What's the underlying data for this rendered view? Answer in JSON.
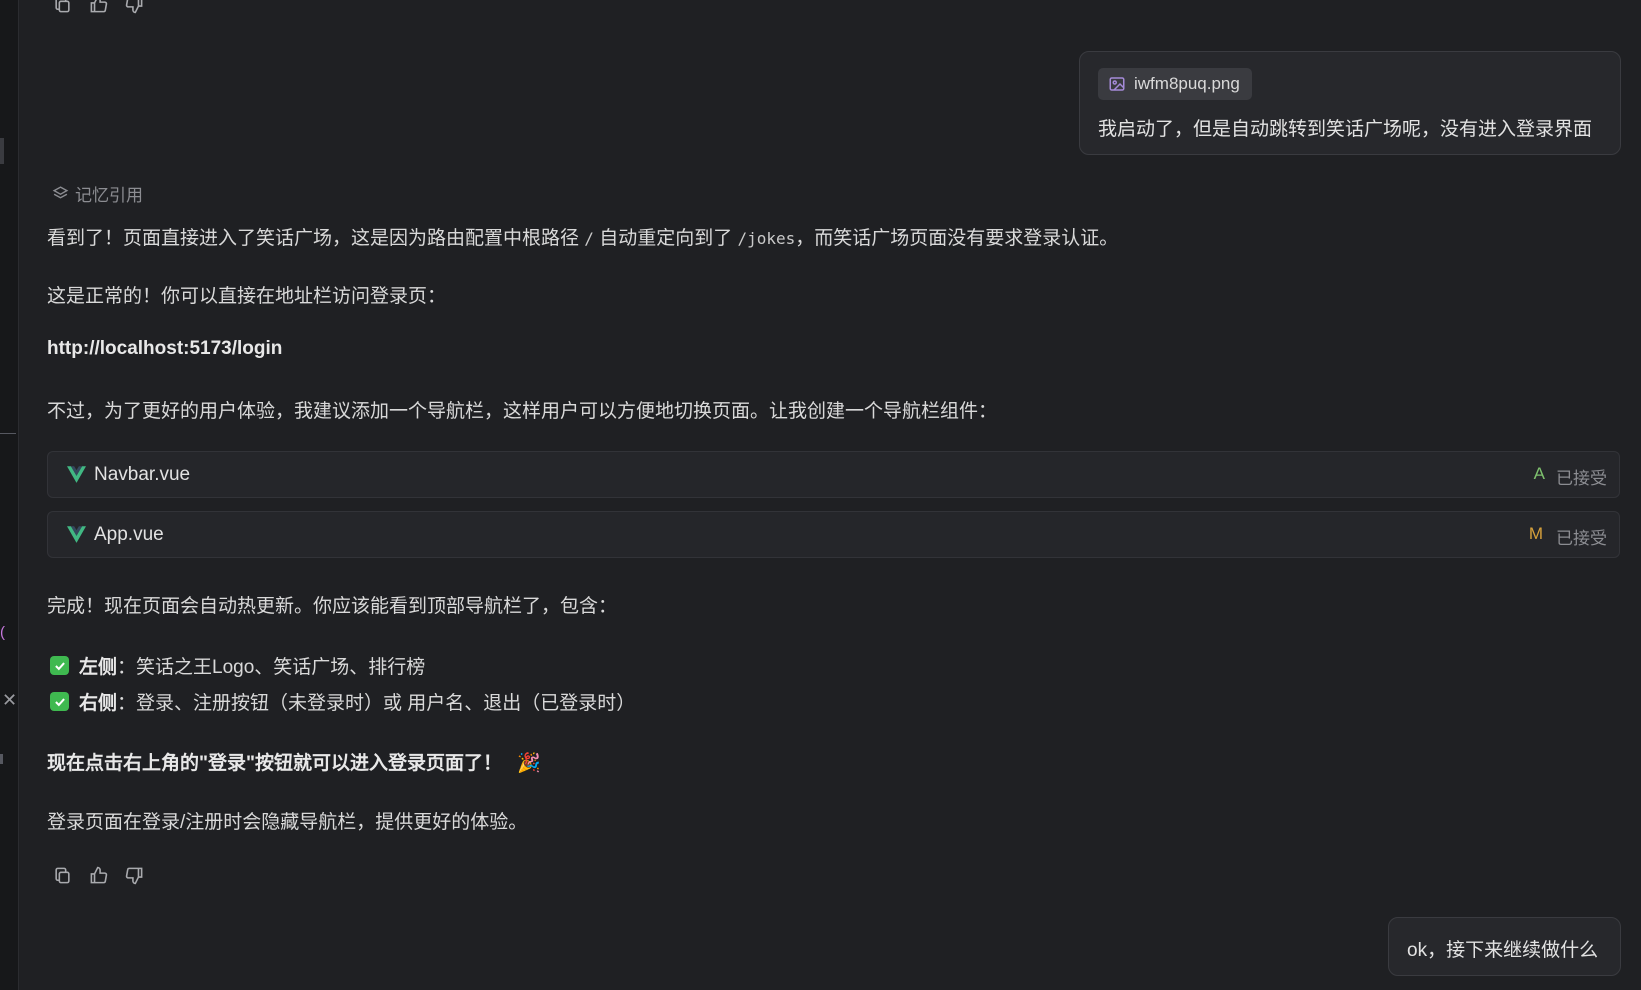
{
  "top_actions": {
    "icons": [
      "copy-icon",
      "thumbs-up-icon",
      "thumbs-down-icon"
    ]
  },
  "user_message": {
    "attachment_name": "iwfm8puq.png",
    "text": "我启动了，但是自动跳转到笑话广场呢，没有进入登录界面"
  },
  "memory_ref": {
    "label": "记忆引用"
  },
  "assistant": {
    "p1_a": "看到了！页面直接进入了笑话广场，这是因为路由配置中根路径 ",
    "p1_code1": "/",
    "p1_b": " 自动重定向到了 ",
    "p1_code2": "/jokes",
    "p1_c": "，而笑话广场页面没有要求登录认证。",
    "p2": "这是正常的！你可以直接在地址栏访问登录页：",
    "login_url": "http://localhost:5173/login",
    "p3": "不过，为了更好的用户体验，我建议添加一个导航栏，这样用户可以方便地切换页面。让我创建一个导航栏组件：",
    "files": [
      {
        "name": "Navbar.vue",
        "badge": "A",
        "status": "已接受"
      },
      {
        "name": "App.vue",
        "badge": "M",
        "status": "已接受"
      }
    ],
    "p4": "完成！现在页面会自动热更新。你应该能看到顶部导航栏了，包含：",
    "checks": [
      {
        "label": "左侧",
        "text": "：笑话之王Logo、笑话广场、排行榜"
      },
      {
        "label": "右侧",
        "text": "：登录、注册按钮（未登录时）或 用户名、退出（已登录时）"
      }
    ],
    "p5": "现在点击右上角的\"登录\"按钮就可以进入登录页面了！",
    "p5_emoji": "🎉",
    "p6": "登录页面在登录/注册时会隐藏导航栏，提供更好的体验。"
  },
  "user_message2": {
    "text": "ok，接下来继续做什么"
  },
  "colors": {
    "background": "#1f2023",
    "badge_added": "#7ec16e",
    "badge_modified": "#d7a13b",
    "checkbox": "#3fb950",
    "vue_green": "#41b883"
  }
}
